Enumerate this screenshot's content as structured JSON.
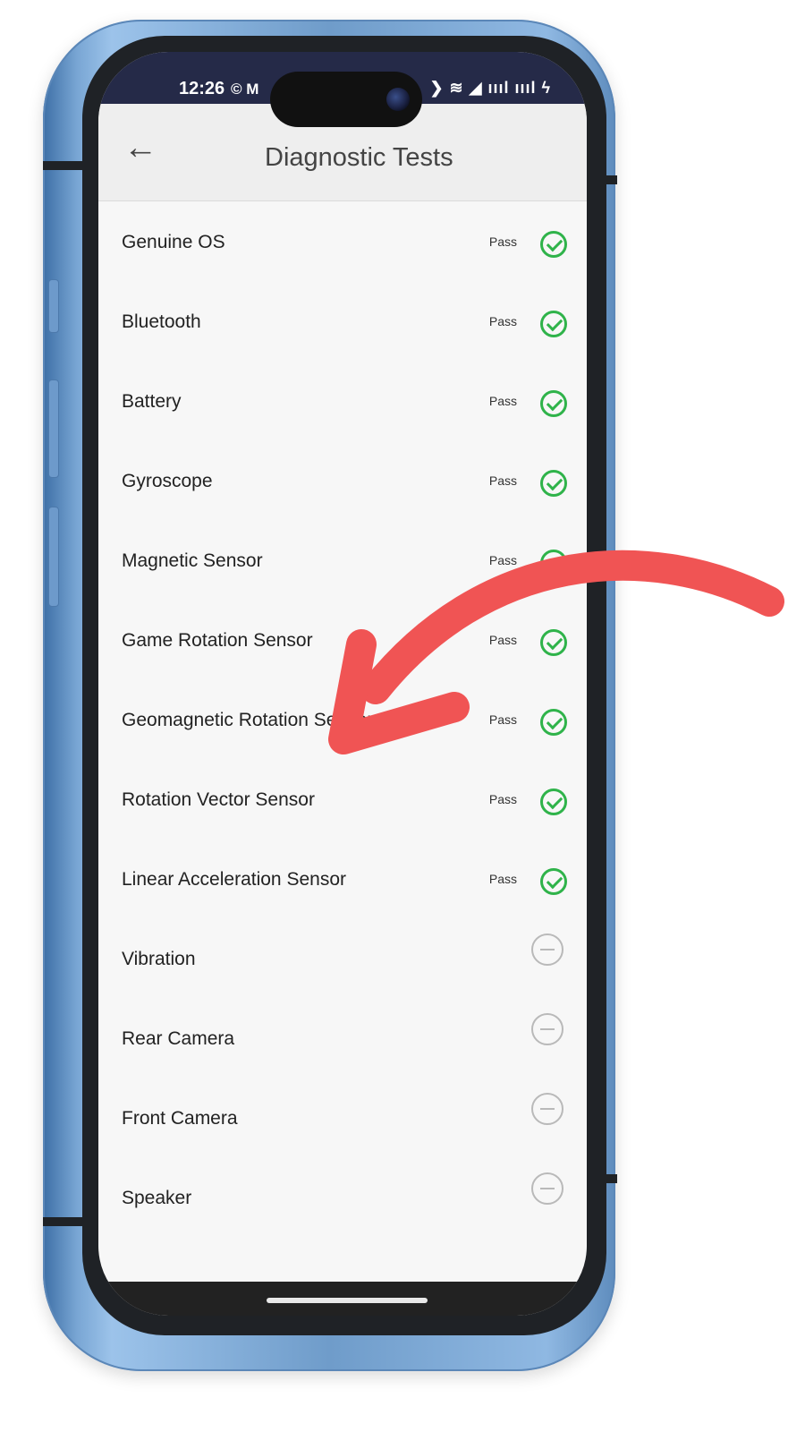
{
  "status_bar": {
    "time": "12:26",
    "left_icons": "© M",
    "right_icons": "❯ ≋ ◢ ıııl ıııl ϟ"
  },
  "app_bar": {
    "title": "Diagnostic Tests",
    "back_icon": "back-arrow-icon"
  },
  "tests": [
    {
      "name": "Genuine OS",
      "status": "Pass",
      "state": "passed"
    },
    {
      "name": "Bluetooth",
      "status": "Pass",
      "state": "passed"
    },
    {
      "name": "Battery",
      "status": "Pass",
      "state": "passed"
    },
    {
      "name": "Gyroscope",
      "status": "Pass",
      "state": "passed"
    },
    {
      "name": "Magnetic Sensor",
      "status": "Pass",
      "state": "passed"
    },
    {
      "name": "Game Rotation Sensor",
      "status": "Pass",
      "state": "passed"
    },
    {
      "name": "Geomagnetic Rotation Sensor",
      "status": "Pass",
      "state": "passed"
    },
    {
      "name": "Rotation Vector Sensor",
      "status": "Pass",
      "state": "passed"
    },
    {
      "name": "Linear Acceleration Sensor",
      "status": "Pass",
      "state": "passed"
    },
    {
      "name": "Vibration",
      "status": "",
      "state": "pending"
    },
    {
      "name": "Rear Camera",
      "status": "",
      "state": "pending"
    },
    {
      "name": "Front Camera",
      "status": "",
      "state": "pending"
    },
    {
      "name": "Speaker",
      "status": "",
      "state": "pending"
    }
  ],
  "colors": {
    "pass": "#2fb34a",
    "pending": "#b9b9b9",
    "annotation_arrow": "#f05454",
    "status_bar": "#252a48",
    "phone_frame": "#6f9cca"
  }
}
